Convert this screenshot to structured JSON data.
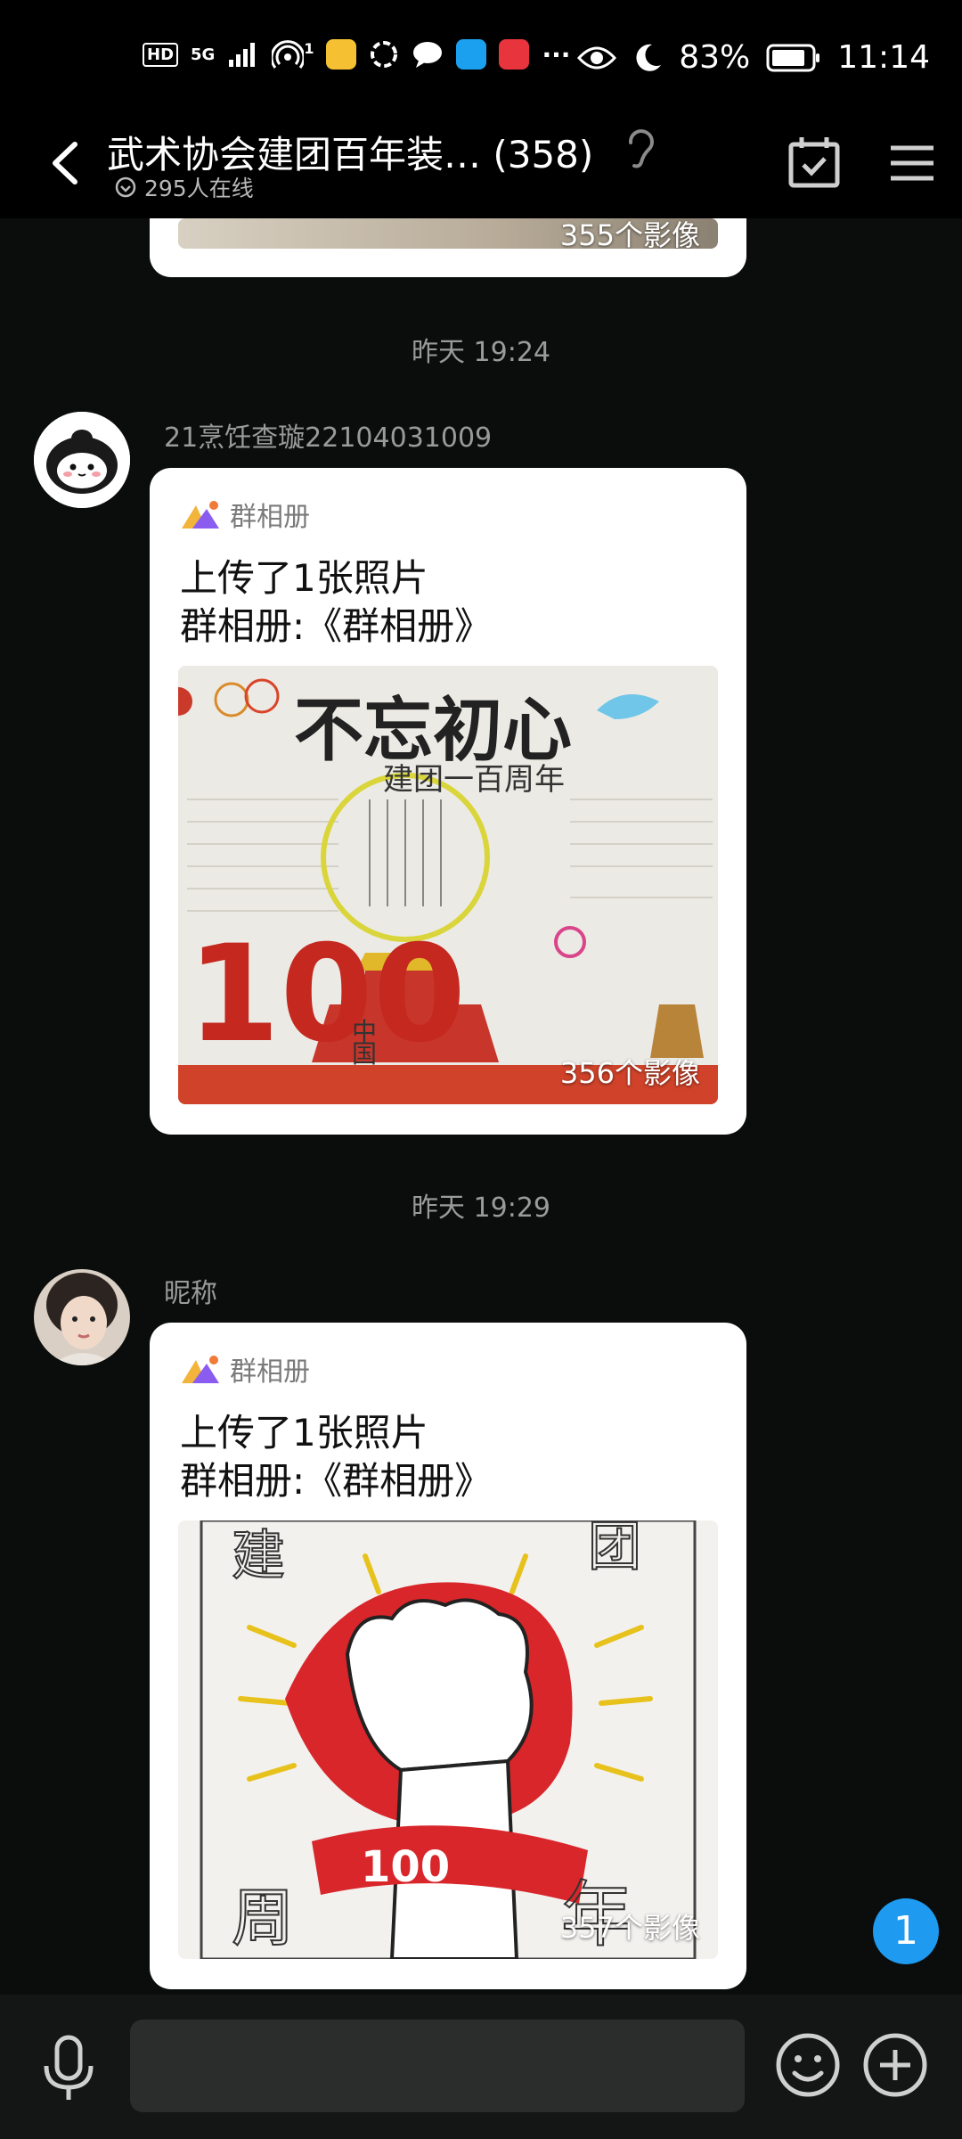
{
  "status_bar": {
    "hd": "HD",
    "signal": "5G",
    "hotspot_count": "1",
    "battery": "83%",
    "time": "11:14",
    "more": "···"
  },
  "header": {
    "title": "武术协会建团百年装… (358)",
    "online": "295人在线"
  },
  "messages": [
    {
      "partial_count": "355个影像"
    },
    {
      "timestamp": "昨天 19:24",
      "sender": "21烹饪查璇22104031009",
      "source": "群相册",
      "line1": "上传了1张照片",
      "line2": "群相册:《群相册》",
      "photo_title": "不忘初心",
      "photo_subtitle": "建团一百周年",
      "photo_count": "356个影像"
    },
    {
      "timestamp": "昨天 19:29",
      "sender": "昵称",
      "source": "群相册",
      "line1": "上传了1张照片",
      "line2": "群相册:《群相册》",
      "photo_count": "357个影像"
    }
  ],
  "unread_badge": "1",
  "icons": {
    "back": "chevron-left-icon",
    "calendar": "calendar-check-icon",
    "menu": "hamburger-icon",
    "mic": "microphone-icon",
    "emoji": "smiley-icon",
    "plus": "plus-circle-icon"
  },
  "colors": {
    "background": "#0b0d0c",
    "bubble": "#ffffff",
    "badge": "#1e9af0"
  }
}
